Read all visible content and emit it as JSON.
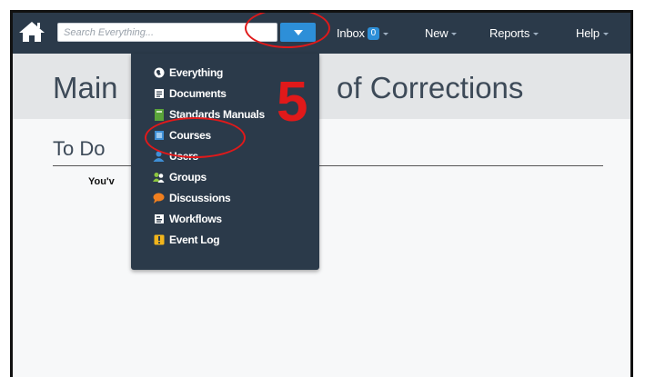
{
  "navbar": {
    "search_placeholder": "Search Everything...",
    "inbox_label": "Inbox",
    "inbox_count": "0",
    "new_label": "New",
    "reports_label": "Reports",
    "help_label": "Help"
  },
  "page": {
    "title_left": "Main",
    "title_right": "of Corrections",
    "todo_heading": "To Do",
    "todo_text": "You'v"
  },
  "search_menu": {
    "items": [
      {
        "label": "Everything",
        "icon": "globe-icon"
      },
      {
        "label": "Documents",
        "icon": "document-icon"
      },
      {
        "label": "Standards Manuals",
        "icon": "manual-icon"
      },
      {
        "label": "Courses",
        "icon": "course-icon"
      },
      {
        "label": "Users",
        "icon": "user-icon"
      },
      {
        "label": "Groups",
        "icon": "group-icon"
      },
      {
        "label": "Discussions",
        "icon": "discussion-icon"
      },
      {
        "label": "Workflows",
        "icon": "workflow-icon"
      },
      {
        "label": "Event Log",
        "icon": "event-log-icon"
      }
    ]
  },
  "annotation": {
    "step": "5",
    "color": "#e0191a"
  },
  "colors": {
    "navbar": "#2b3a4a",
    "accent": "#2d8fd8",
    "title_band": "#e3e5e7"
  }
}
